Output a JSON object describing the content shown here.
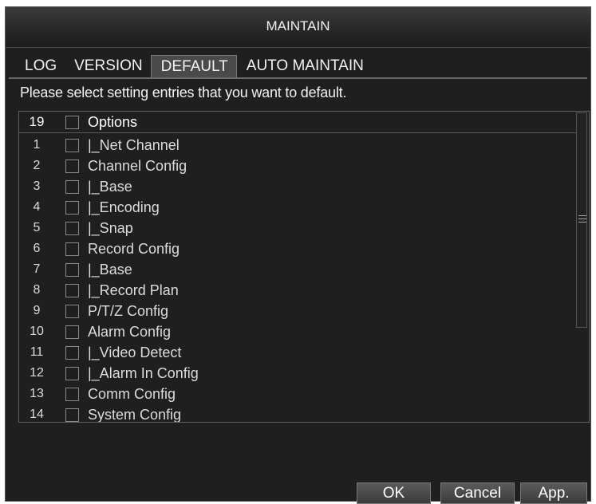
{
  "window": {
    "title": "MAINTAIN"
  },
  "tabs": [
    {
      "label": "LOG",
      "active": false
    },
    {
      "label": "VERSION",
      "active": false
    },
    {
      "label": "DEFAULT",
      "active": true
    },
    {
      "label": "AUTO MAINTAIN",
      "active": false
    }
  ],
  "prompt": "Please select setting entries that you want to default.",
  "list": {
    "header": {
      "count": "19",
      "label": "Options",
      "checked": false
    },
    "items": [
      {
        "num": "1",
        "label": "|_Net Channel",
        "checked": false
      },
      {
        "num": "2",
        "label": "Channel Config",
        "checked": false
      },
      {
        "num": "3",
        "label": "|_Base",
        "checked": false
      },
      {
        "num": "4",
        "label": "|_Encoding",
        "checked": false
      },
      {
        "num": "5",
        "label": "|_Snap",
        "checked": false
      },
      {
        "num": "6",
        "label": "Record Config",
        "checked": false
      },
      {
        "num": "7",
        "label": "|_Base",
        "checked": false
      },
      {
        "num": "8",
        "label": "|_Record Plan",
        "checked": false
      },
      {
        "num": "9",
        "label": "P/T/Z Config",
        "checked": false
      },
      {
        "num": "10",
        "label": "Alarm Config",
        "checked": false
      },
      {
        "num": "11",
        "label": "|_Video Detect",
        "checked": false
      },
      {
        "num": "12",
        "label": "|_Alarm In Config",
        "checked": false
      },
      {
        "num": "13",
        "label": "Comm Config",
        "checked": false
      },
      {
        "num": "14",
        "label": "System Config",
        "checked": false
      }
    ]
  },
  "buttons": {
    "ok": "OK",
    "cancel": "Cancel",
    "apply": "App."
  },
  "colors": {
    "background": "#1f1f1f",
    "text": "#dcdcdc",
    "border": "#606060"
  }
}
